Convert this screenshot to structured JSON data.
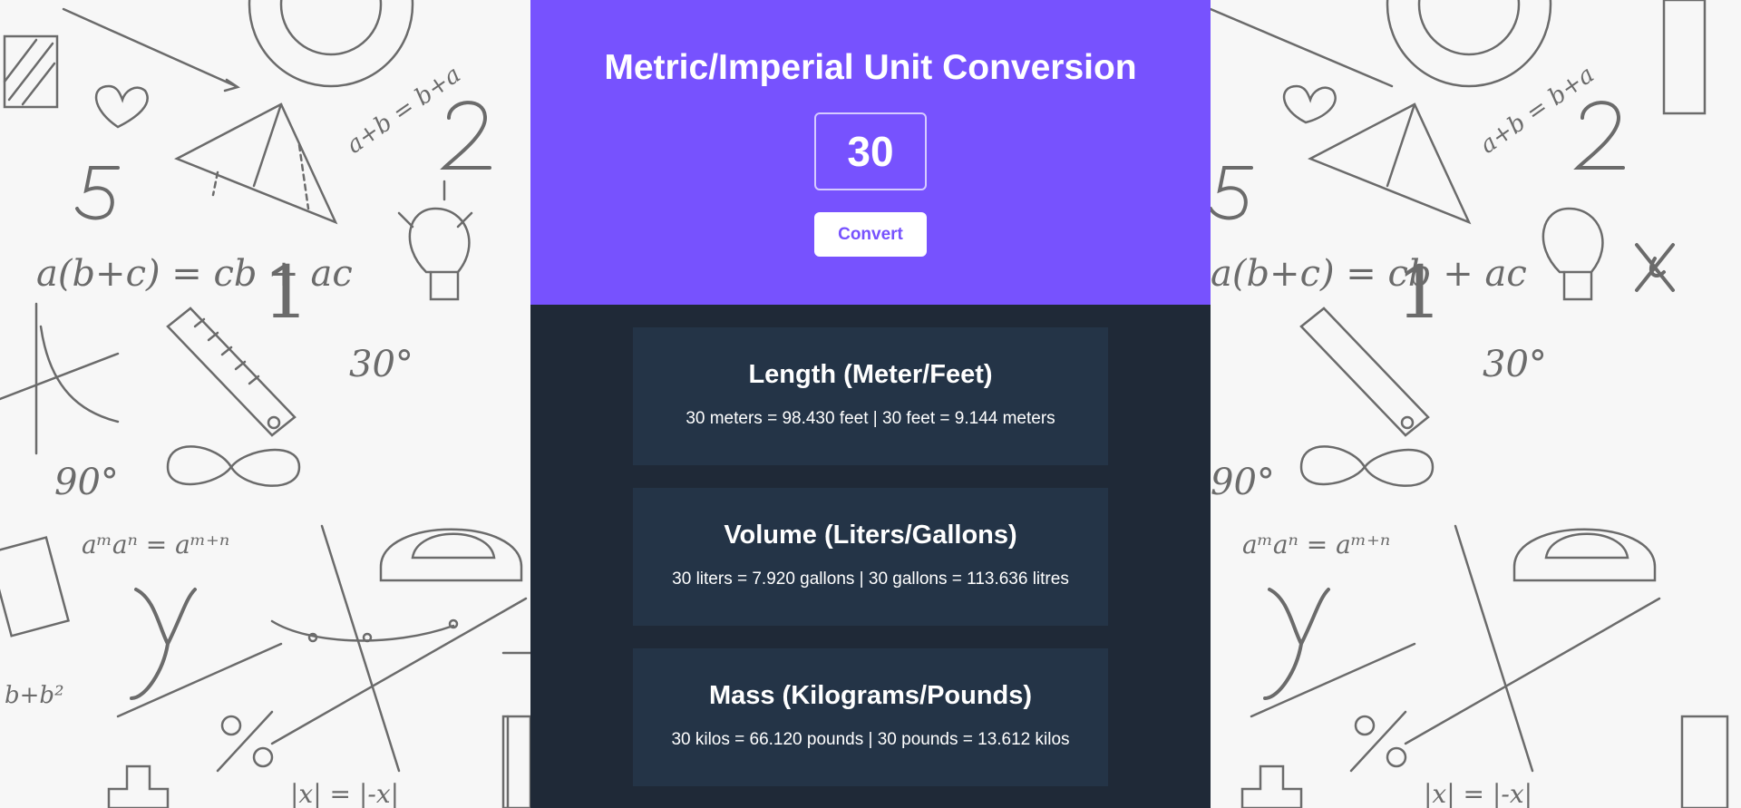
{
  "header": {
    "title": "Metric/Imperial Unit Conversion",
    "input_value": "30",
    "convert_label": "Convert",
    "accent_color": "#7752fe"
  },
  "results": [
    {
      "heading": "Length (Meter/Feet)",
      "text": "30 meters = 98.430 feet | 30 feet = 9.144 meters"
    },
    {
      "heading": "Volume (Liters/Gallons)",
      "text": "30 liters = 7.920 gallons | 30 gallons = 113.636 litres"
    },
    {
      "heading": "Mass (Kilograms/Pounds)",
      "text": "30 kilos = 66.120 pounds | 30 pounds = 13.612 kilos"
    }
  ],
  "background": {
    "formulas": [
      "a(b+c) = cb + ac",
      "a^m a^n = a^(m+n)",
      "a+b = b+a",
      "|x| = |-x|",
      "30°",
      "90°",
      "2",
      "5",
      "1",
      "y",
      "%"
    ]
  }
}
